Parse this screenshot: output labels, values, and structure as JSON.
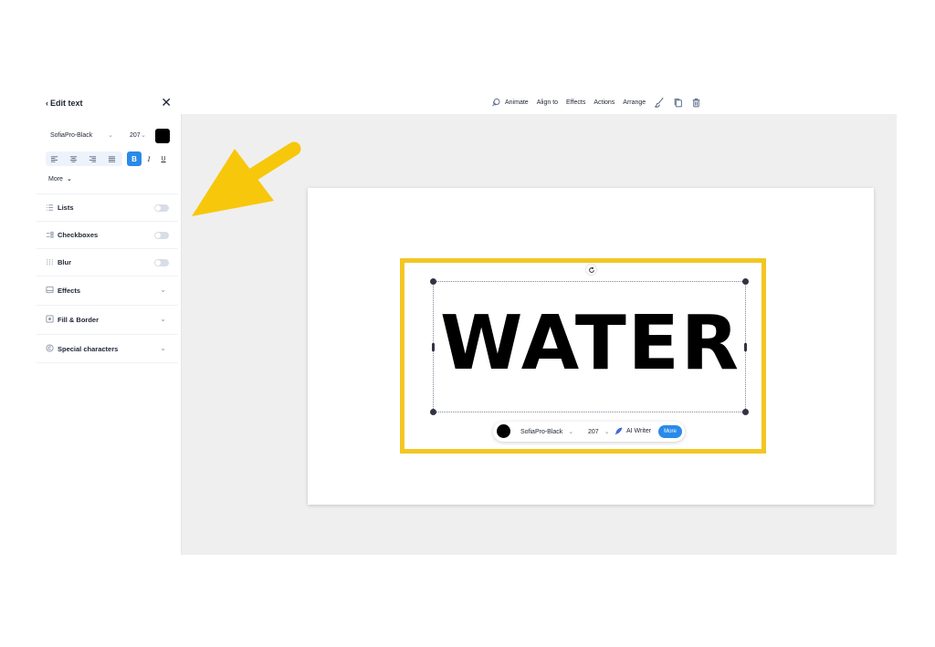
{
  "panel": {
    "back_label": "Edit text",
    "font_family": "SofiaPro-Black",
    "font_size": "207",
    "text_color": "#000000",
    "bold_label": "B",
    "italic_label": "I",
    "underline_label": "U",
    "more_label": "More",
    "sections": [
      {
        "label": "Lists",
        "icon": "list-icon",
        "control": "toggle",
        "state": "off"
      },
      {
        "label": "Checkboxes",
        "icon": "checkbox-icon",
        "control": "toggle",
        "state": "off"
      },
      {
        "label": "Blur",
        "icon": "blur-icon",
        "control": "toggle",
        "state": "off"
      },
      {
        "label": "Effects",
        "icon": "effects-icon",
        "control": "expand"
      },
      {
        "label": "Fill & Border",
        "icon": "fill-icon",
        "control": "expand"
      },
      {
        "label": "Special characters",
        "icon": "copyright-icon",
        "control": "expand"
      }
    ]
  },
  "toolbar": {
    "animate_label": "Animate",
    "align_label": "Align to",
    "effects_label": "Effects",
    "actions_label": "Actions",
    "arrange_label": "Arrange"
  },
  "canvas": {
    "text": "WATER",
    "highlight_color": "#f3c623",
    "accent_color": "#2a8ae8"
  },
  "floating_bar": {
    "font_family": "SofiaPro-Black",
    "font_size": "207",
    "ai_label": "AI Writer",
    "more_label": "More"
  }
}
